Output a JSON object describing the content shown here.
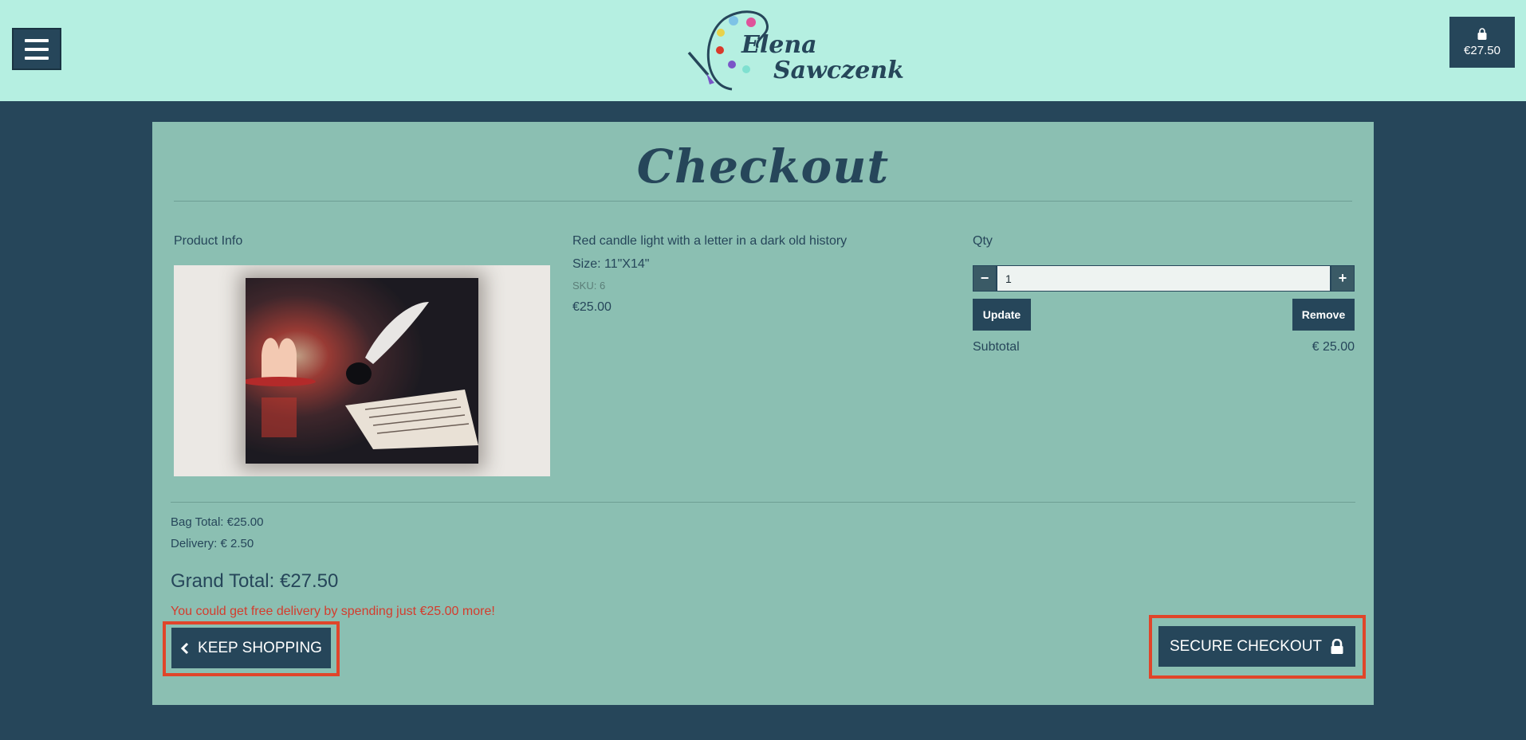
{
  "header": {
    "logo": {
      "line1": "Elena",
      "line2": "Sawczenko"
    },
    "bag_total": "€27.50"
  },
  "checkout": {
    "title": "Checkout",
    "product_info_label": "Product Info",
    "product": {
      "name": "Red candle light with a letter in a dark old history",
      "size": "Size: 11\"X14\"",
      "sku": "SKU: 6",
      "price": "€25.00"
    },
    "qty": {
      "label": "Qty",
      "value": "1",
      "decrement": "−",
      "increment": "+",
      "update_label": "Update",
      "remove_label": "Remove"
    },
    "subtotal_label": "Subtotal",
    "subtotal_value": "€ 25.00",
    "bag_total": "Bag Total: €25.00",
    "delivery": "Delivery: € 2.50",
    "grand_total": "Grand Total: €27.50",
    "free_delivery_msg": "You could get free delivery by spending just €25.00 more!",
    "keep_shopping_label": "KEEP SHOPPING",
    "secure_checkout_label": "SECURE CHECKOUT"
  },
  "colors": {
    "header_bg": "#b5efe1",
    "page_bg": "#26465a",
    "card_bg": "#8bbfb2",
    "accent": "#26465a",
    "warning_text": "#d43c2d",
    "highlight": "#e0452a"
  },
  "icons": [
    "hamburger-icon",
    "shopping-bag-icon",
    "chevron-left-icon",
    "lock-icon",
    "palette-logo"
  ]
}
